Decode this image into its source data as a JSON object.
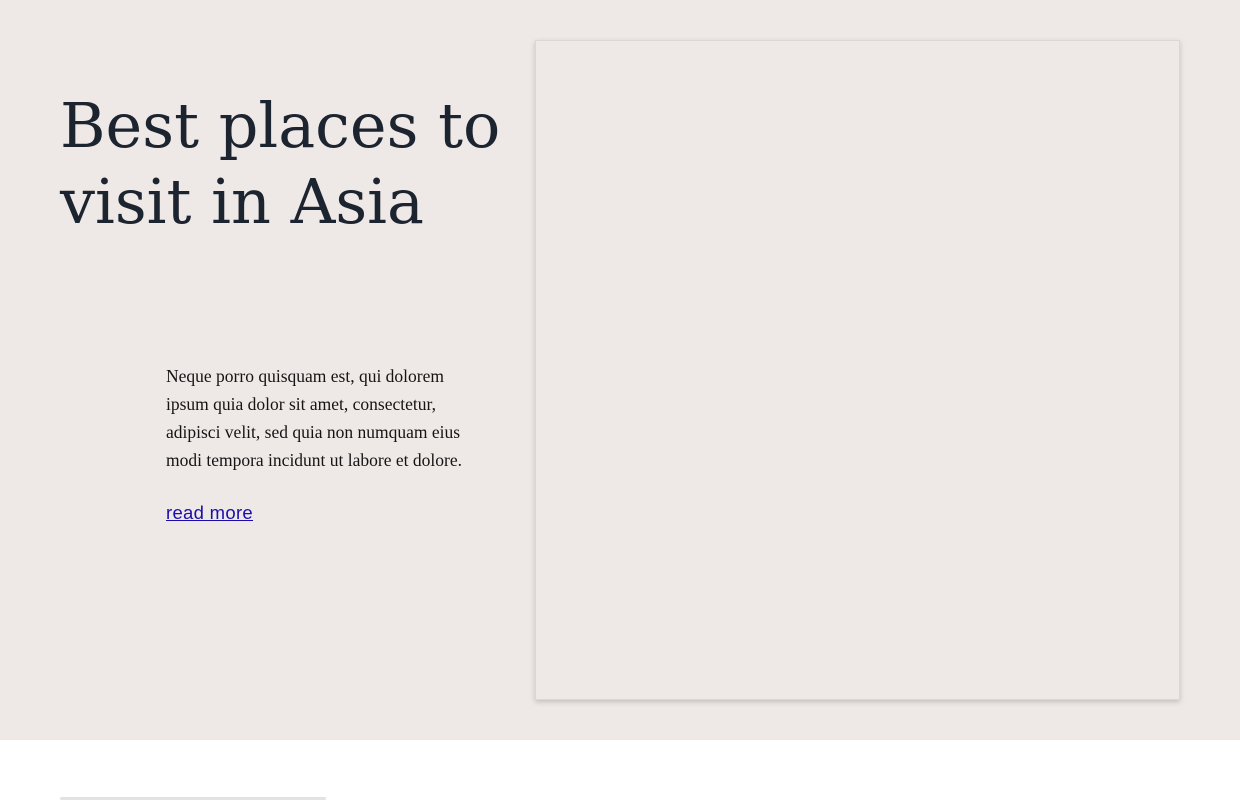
{
  "hero": {
    "title": "Best places to visit in Asia",
    "description": "Neque porro quisquam est, qui dolorem ipsum quia dolor sit amet, consectetur, adipisci velit, sed quia non numquam eius modi tempora incidunt ut labore et dolore.",
    "read_more_label": "read more"
  },
  "colors": {
    "hero_background": "#eee8e6",
    "title_text": "#1c2430",
    "link": "#1a0dab"
  }
}
